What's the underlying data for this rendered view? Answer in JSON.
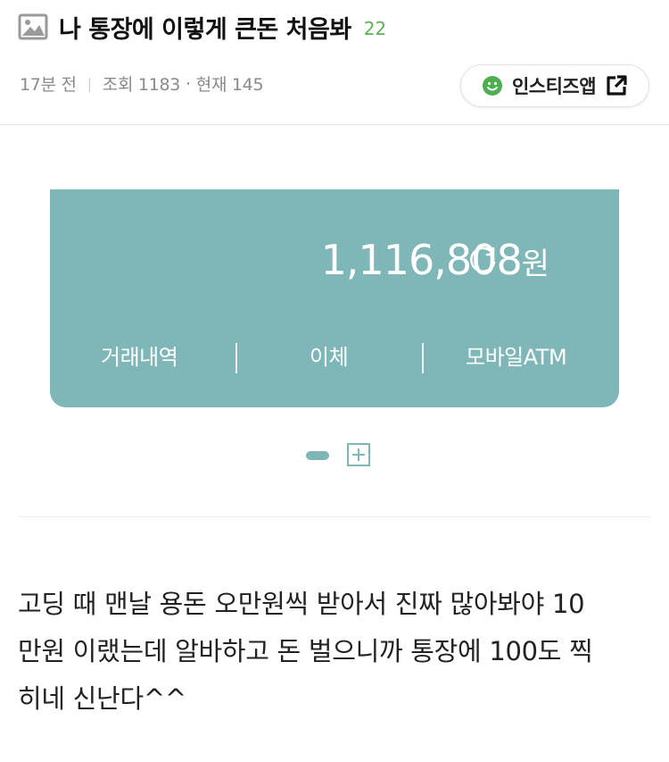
{
  "post": {
    "title": "나 통장에 이렇게 큰돈 처음봐",
    "comment_count": "22",
    "time_ago": "17분 전",
    "views_label": "조회 1183",
    "dot": "·",
    "current_label": "현재 145",
    "app_button_label": "인스티즈앱"
  },
  "bank_card": {
    "balance_value": "1,116,808",
    "balance_unit": "원",
    "actions": [
      "거래내역",
      "이체",
      "모바일ATM"
    ]
  },
  "body": {
    "lines": [
      "고딩 때 맨날 용돈 오만원씩 받아서 진짜 많아봐야 10",
      "만원 이랬는데 알바하고 돈 벌으니까 통장에 100도 찍",
      "히네 신난다^^"
    ]
  },
  "colors": {
    "card_bg": "#7fb6b8",
    "comment_green": "#5fb05a",
    "smile_green": "#4caf50"
  },
  "icons": [
    "image-icon",
    "smile-icon",
    "external-link-icon",
    "refresh-icon",
    "plus-icon"
  ]
}
